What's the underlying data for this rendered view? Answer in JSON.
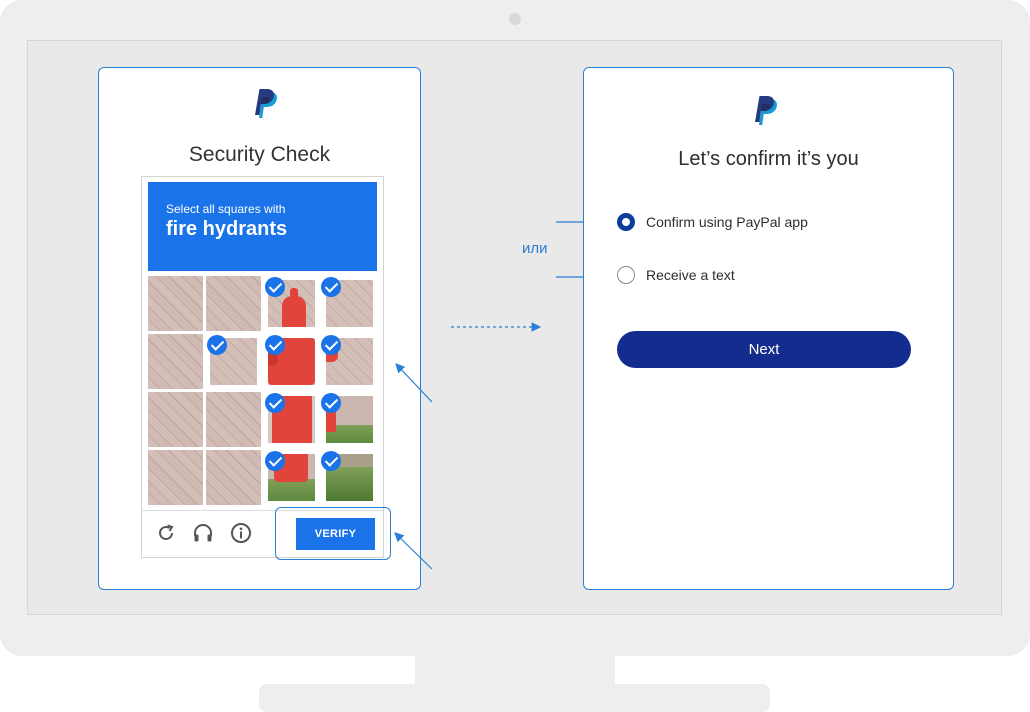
{
  "captcha": {
    "title": "Security Check",
    "instruction": "Select all squares with",
    "target": "fire hydrants",
    "verify_label": "VERIFY",
    "grid": [
      [
        false,
        false,
        true,
        true
      ],
      [
        false,
        true,
        true,
        true
      ],
      [
        false,
        false,
        true,
        true
      ],
      [
        false,
        false,
        true,
        true
      ]
    ],
    "controls": [
      "reload-icon",
      "headphones-icon",
      "info-icon"
    ]
  },
  "separator": {
    "label": "или"
  },
  "confirm": {
    "title": "Let’s confirm it’s you",
    "options": [
      {
        "label": "Confirm using PayPal app",
        "selected": true
      },
      {
        "label": "Receive a text",
        "selected": false
      }
    ],
    "next_label": "Next"
  },
  "colors": {
    "captcha_blue": "#1a73e8",
    "annotation_blue": "#2a7fd6",
    "paypal_navy": "#142c8e",
    "paypal_dark": "#253b80",
    "paypal_light": "#179bd7"
  }
}
